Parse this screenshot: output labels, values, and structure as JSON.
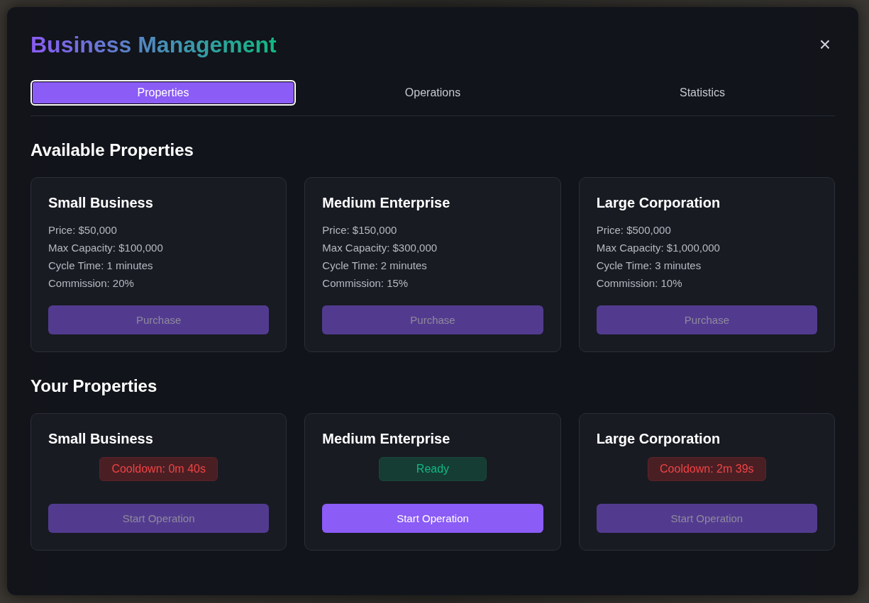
{
  "modal": {
    "title": "Business Management",
    "close": "×"
  },
  "tabs": [
    {
      "label": "Properties",
      "selected": true
    },
    {
      "label": "Operations",
      "selected": false
    },
    {
      "label": "Statistics",
      "selected": false
    }
  ],
  "available": {
    "heading": "Available Properties",
    "cards": [
      {
        "name": "Small Business",
        "details": [
          "Price: $50,000",
          "Max Capacity: $100,000",
          "Cycle Time: 1 minutes",
          "Commission: 20%"
        ],
        "button": {
          "label": "Purchase",
          "disabled": true
        }
      },
      {
        "name": "Medium Enterprise",
        "details": [
          "Price: $150,000",
          "Max Capacity: $300,000",
          "Cycle Time: 2 minutes",
          "Commission: 15%"
        ],
        "button": {
          "label": "Purchase",
          "disabled": true
        }
      },
      {
        "name": "Large Corporation",
        "details": [
          "Price: $500,000",
          "Max Capacity: $1,000,000",
          "Cycle Time: 3 minutes",
          "Commission: 10%"
        ],
        "button": {
          "label": "Purchase",
          "disabled": true
        }
      }
    ]
  },
  "owned": {
    "heading": "Your Properties",
    "cards": [
      {
        "name": "Small Business",
        "status": {
          "kind": "cooldown",
          "text": "Cooldown: 0m 40s"
        },
        "button": {
          "label": "Start Operation",
          "disabled": true
        }
      },
      {
        "name": "Medium Enterprise",
        "status": {
          "kind": "ready",
          "text": "Ready"
        },
        "button": {
          "label": "Start Operation",
          "disabled": false
        }
      },
      {
        "name": "Large Corporation",
        "status": {
          "kind": "cooldown",
          "text": "Cooldown: 2m 39s"
        },
        "button": {
          "label": "Start Operation",
          "disabled": true
        }
      }
    ]
  }
}
